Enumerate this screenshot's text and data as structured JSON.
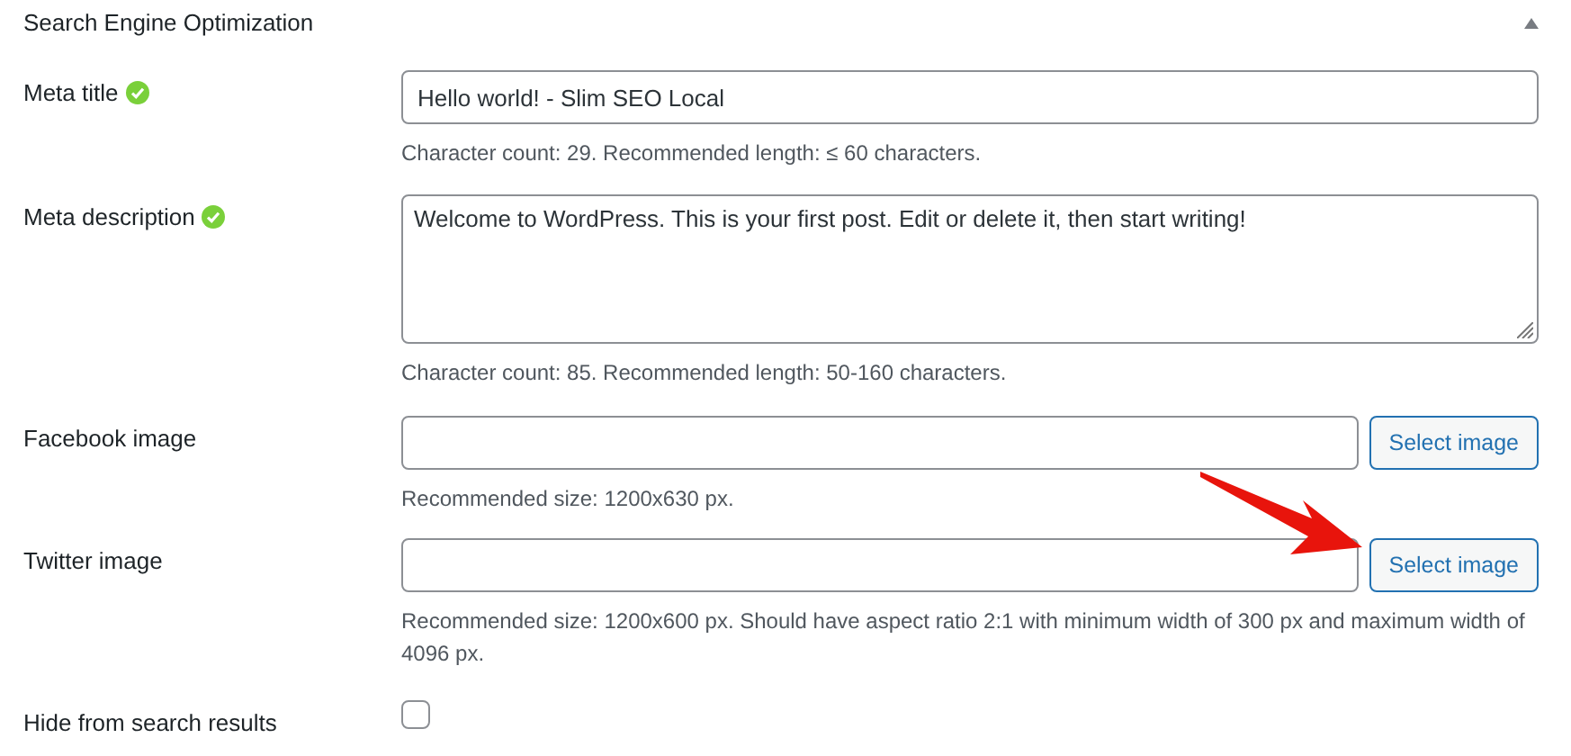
{
  "panel": {
    "title": "Search Engine Optimization",
    "expanded": true
  },
  "fields": [
    {
      "kind": "text",
      "label": "Meta title",
      "valid": true,
      "value": "Hello world! - Slim SEO Local",
      "hint": "Character count: 29. Recommended length: ≤ 60 characters."
    },
    {
      "kind": "textarea",
      "label": "Meta description",
      "valid": true,
      "value": "Welcome to WordPress. This is your first post. Edit or delete it, then start writing!",
      "hint": "Character count: 85. Recommended length: 50-160 characters."
    },
    {
      "kind": "image",
      "label": "Facebook image",
      "button": "Select image",
      "hint": "Recommended size: 1200x630 px."
    },
    {
      "kind": "image",
      "label": "Twitter image",
      "button": "Select image",
      "hint": "Recommended size: 1200x600 px. Should have aspect ratio 2:1 with minimum width of 300 px and maximum width of 4096 px."
    },
    {
      "kind": "checkbox",
      "label": "Hide from search results",
      "checked": false
    }
  ]
}
